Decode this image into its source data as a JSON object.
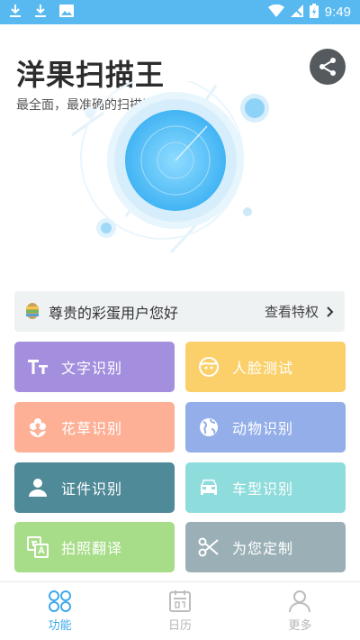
{
  "status_bar": {
    "time": "9:49"
  },
  "app": {
    "title": "洋果扫描王",
    "subtitle": "最全面，最准确的扫描识别"
  },
  "vip": {
    "greeting": "尊贵的彩蛋用户您好",
    "link": "查看特权"
  },
  "tiles": [
    {
      "label": "文字识别",
      "color": "#a48fde",
      "icon": "text-icon"
    },
    {
      "label": "人脸测试",
      "color": "#fbd06b",
      "icon": "face-icon"
    },
    {
      "label": "花草识别",
      "color": "#fdb096",
      "icon": "flower-icon"
    },
    {
      "label": "动物识别",
      "color": "#93aee9",
      "icon": "globe-icon"
    },
    {
      "label": "证件识别",
      "color": "#4f8a99",
      "icon": "person-icon"
    },
    {
      "label": "车型识别",
      "color": "#8fdcdc",
      "icon": "car-icon"
    },
    {
      "label": "拍照翻译",
      "color": "#a7dd88",
      "icon": "translate-icon"
    },
    {
      "label": "为您定制",
      "color": "#9bb0b6",
      "icon": "scissors-icon"
    }
  ],
  "bottom_nav": [
    {
      "label": "功能",
      "active": true
    },
    {
      "label": "日历",
      "active": false
    },
    {
      "label": "更多",
      "active": false
    }
  ],
  "colors": {
    "accent": "#3ea9ec",
    "status_bar": "#58b9f0"
  }
}
